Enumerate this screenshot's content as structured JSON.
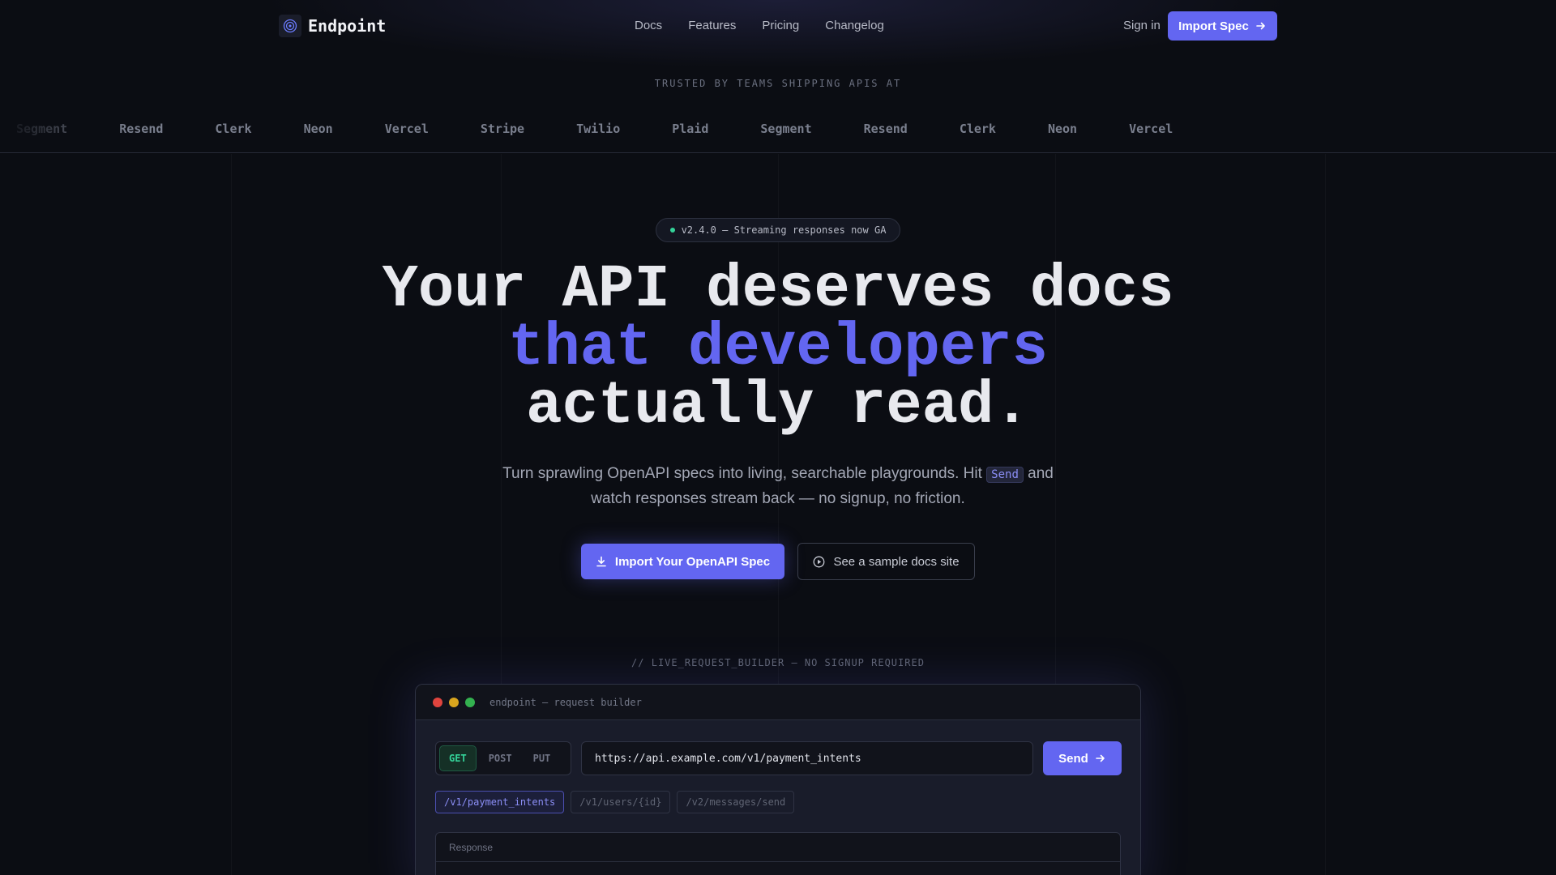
{
  "nav": {
    "brand": "Endpoint",
    "links": [
      "Docs",
      "Features",
      "Pricing",
      "Changelog"
    ],
    "signin": "Sign in",
    "cta": "Import Spec"
  },
  "trusted": {
    "label": "TRUSTED BY TEAMS SHIPPING APIS AT",
    "logos": [
      "Segment",
      "Resend",
      "Clerk",
      "Neon",
      "Vercel",
      "Stripe",
      "Twilio",
      "Plaid",
      "Segment",
      "Resend",
      "Clerk",
      "Neon",
      "Vercel"
    ]
  },
  "hero": {
    "badge": "v2.4.0 — Streaming responses now GA",
    "title_line1": "Your API deserves docs",
    "title_line2": "that developers",
    "title_line3": "actually read.",
    "sub_before": "Turn sprawling OpenAPI specs into living, searchable playgrounds. Hit ",
    "sub_code": "Send",
    "sub_after": " and watch responses stream back — no signup, no friction.",
    "cta_primary": "Import Your OpenAPI Spec",
    "cta_secondary": "See a sample docs site"
  },
  "builder": {
    "label": "// LIVE_REQUEST_BUILDER — NO SIGNUP REQUIRED",
    "window_title": "endpoint — request builder",
    "methods": [
      "GET",
      "POST",
      "PUT"
    ],
    "active_method": "GET",
    "url": "https://api.example.com/v1/payment_intents",
    "send": "Send",
    "presets": [
      "/v1/payment_intents",
      "/v1/users/{id}",
      "/v2/messages/send"
    ],
    "response_label": "Response"
  },
  "colors": {
    "accent": "#6366f1",
    "success": "#34d399",
    "background": "#0b0d13",
    "traffic_red": "#e0443e",
    "traffic_yellow": "#d9a51e",
    "traffic_green": "#33b14f"
  }
}
